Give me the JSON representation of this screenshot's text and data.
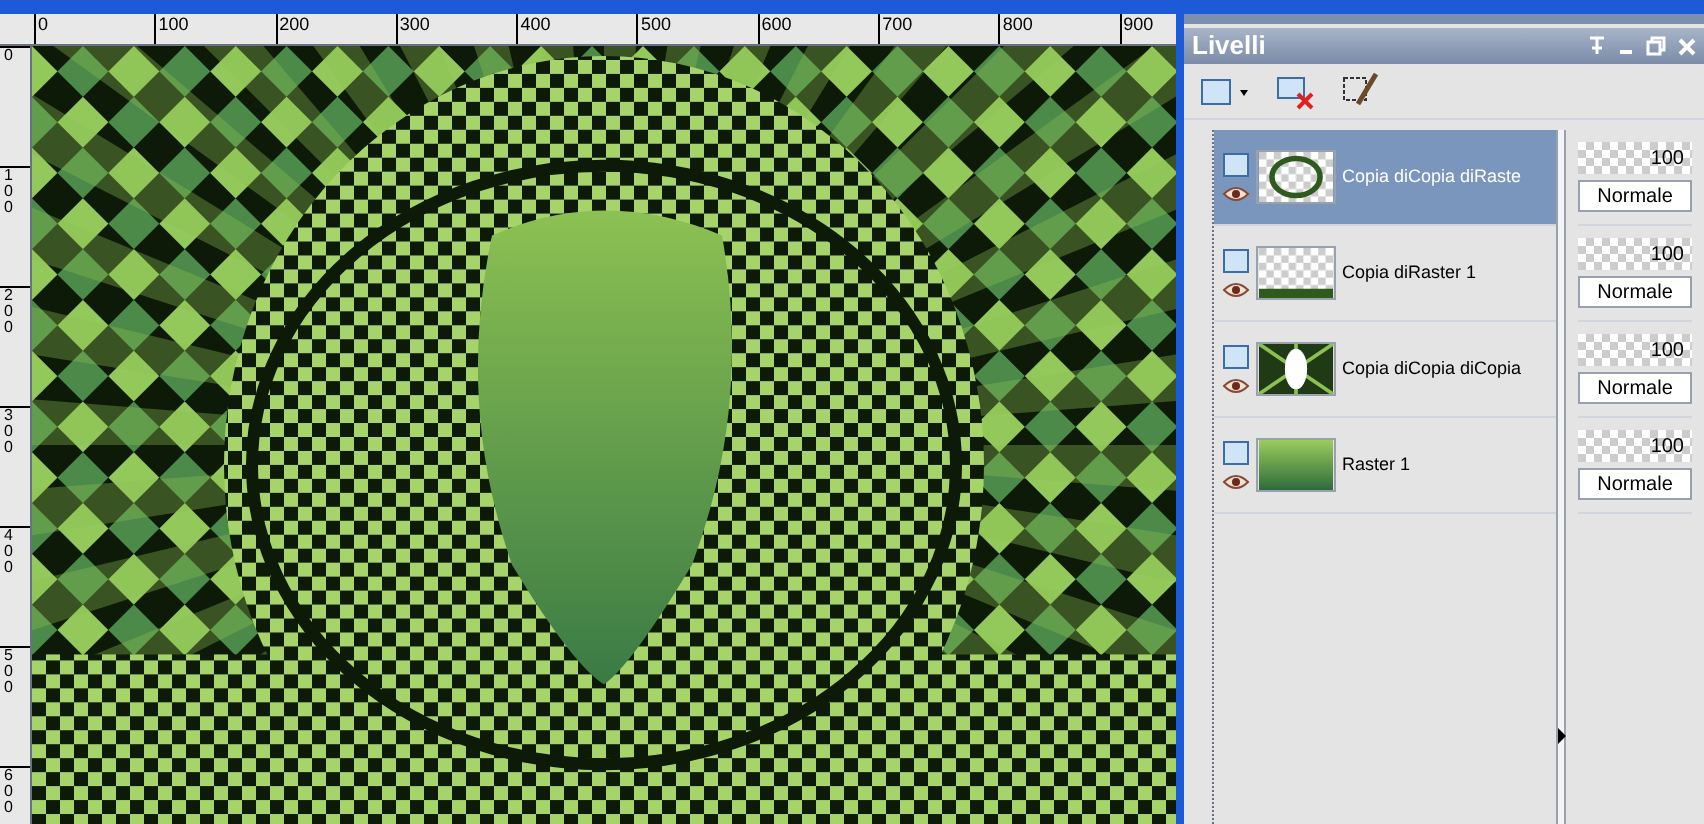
{
  "ruler": {
    "horizontal_labels": [
      "0",
      "100",
      "200",
      "300",
      "400",
      "500",
      "600",
      "700",
      "800",
      "900"
    ],
    "vertical_labels": [
      "0",
      "100",
      "200",
      "300",
      "400",
      "500",
      "600"
    ]
  },
  "panel": {
    "title": "Livelli",
    "layers": [
      {
        "name": "Copia diCopia diRaste",
        "selected": true,
        "opacity": "100",
        "blend": "Normale",
        "kind": "ring"
      },
      {
        "name": "Copia diRaster 1",
        "selected": false,
        "opacity": "100",
        "blend": "Normale",
        "kind": "strip"
      },
      {
        "name": "Copia diCopia diCopia",
        "selected": false,
        "opacity": "100",
        "blend": "Normale",
        "kind": "checker"
      },
      {
        "name": "Raster 1",
        "selected": false,
        "opacity": "100",
        "blend": "Normale",
        "kind": "gradient"
      }
    ]
  }
}
